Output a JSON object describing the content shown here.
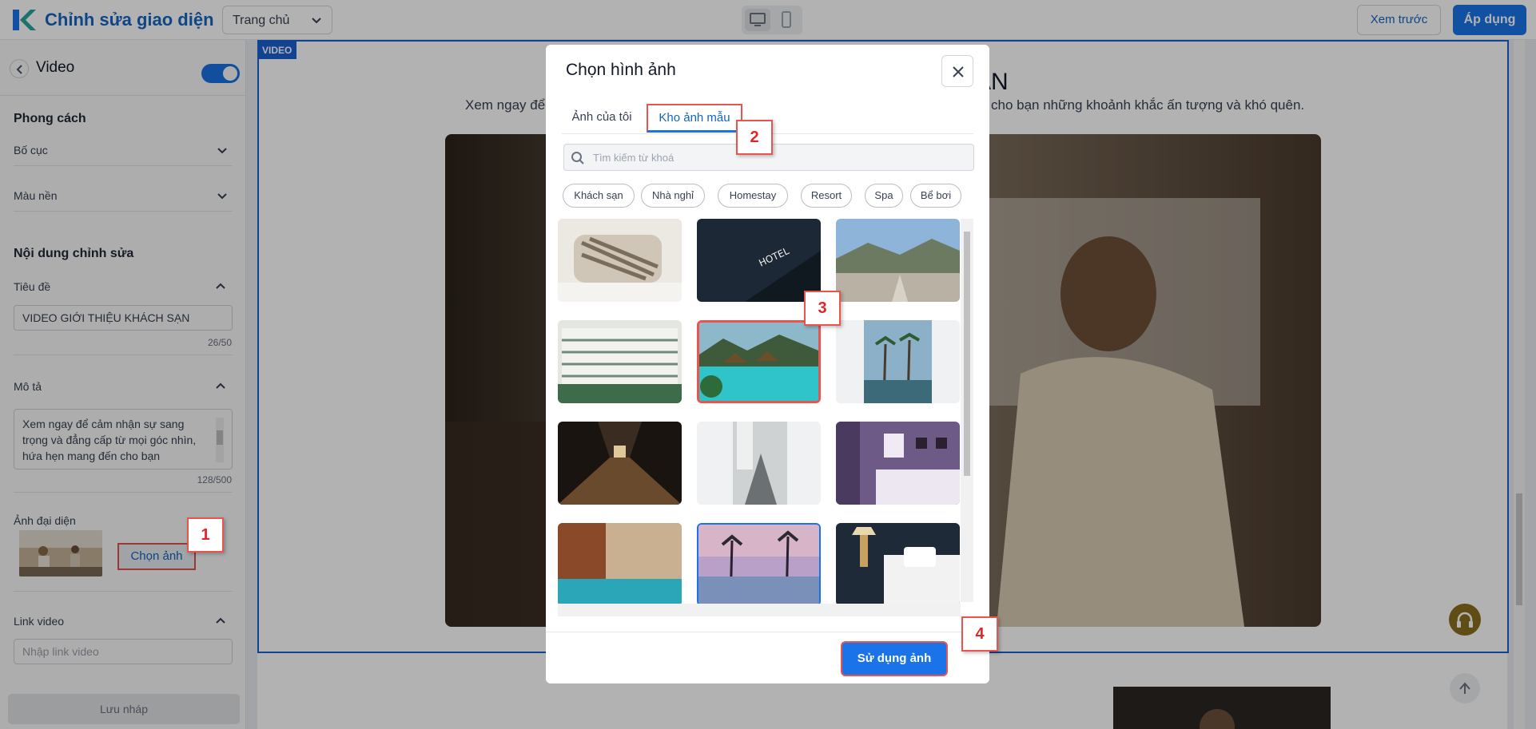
{
  "app": {
    "title": "Chỉnh sửa giao diện",
    "page_select": "Trang chủ",
    "preview_label": "Xem trước",
    "apply_label": "Áp dụng",
    "accent_color": "#1a73e8",
    "callout_color": "#e8554e"
  },
  "left_panel": {
    "title": "Video",
    "toggle_on": true,
    "style_section": "Phong cách",
    "layout_label": "Bố cục",
    "bg_color_label": "Màu nền",
    "content_section": "Nội dung chỉnh sửa",
    "title_field": {
      "label": "Tiêu đề",
      "value": "VIDEO GIỚI THIỆU KHÁCH SẠN",
      "counter": "26/50"
    },
    "desc_field": {
      "label": "Mô tả",
      "value": "Xem ngay để cảm nhận sự sang trọng và đẳng cấp từ mọi góc nhìn, hứa hẹn mang đến cho bạn",
      "counter": "128/500"
    },
    "avatar_label": "Ảnh đại diện",
    "choose_image_label": "Chọn ảnh",
    "link_label": "Link video",
    "link_placeholder": "Nhập link video",
    "save_draft_label": "Lưu nháp"
  },
  "canvas": {
    "badge": "VIDEO",
    "heading_visible": "H SẠN",
    "desc_left": "Xem ngay để",
    "desc_right": "cho bạn những khoảnh khắc ấn tượng và khó quên."
  },
  "modal": {
    "title": "Chọn hình ảnh",
    "tabs": [
      "Ảnh của tôi",
      "Kho ảnh mẫu"
    ],
    "active_tab": "Kho ảnh mẫu",
    "search_placeholder": "Tìm kiếm từ khoá",
    "chips": [
      "Khách sạn",
      "Nhà nghỉ",
      "Homestay",
      "Resort",
      "Spa",
      "Bể bơi"
    ],
    "images": [
      "pillows",
      "hotel-sign-night",
      "rooftop-mountains",
      "hotel-courtyard",
      "tropical-pool",
      "palm-resort",
      "hotel-corridor",
      "stairwell",
      "purple-bedroom",
      "indoor-pool",
      "palm-sunset-pool",
      "dark-bedroom"
    ],
    "use_image_label": "Sử dụng ảnh"
  },
  "callouts": [
    "1",
    "2",
    "3",
    "4"
  ]
}
